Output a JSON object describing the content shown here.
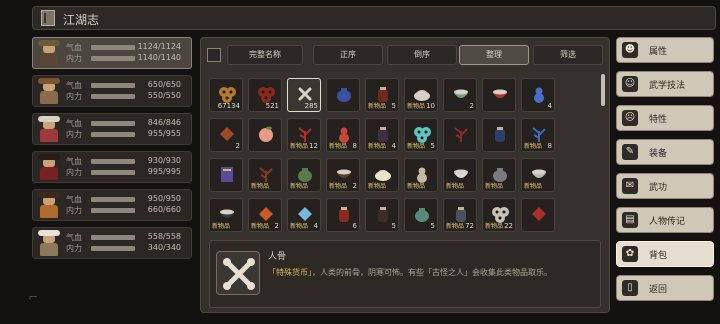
{
  "header": {
    "title": "江湖志"
  },
  "characters": [
    {
      "qi_label": "气血",
      "neili_label": "内力",
      "qi": "1124/1124",
      "neili": "1140/1140",
      "active": true,
      "hat": "#6b5a3e",
      "body": "#5a4632"
    },
    {
      "qi_label": "气血",
      "neili_label": "内力",
      "qi": "650/650",
      "neili": "550/550",
      "active": false,
      "hat": "#7a5530",
      "body": "#8a6a4a"
    },
    {
      "qi_label": "气血",
      "neili_label": "内力",
      "qi": "846/846",
      "neili": "955/955",
      "active": false,
      "hat": "#d8d0c0",
      "body": "#9a3a3a"
    },
    {
      "qi_label": "气血",
      "neili_label": "内力",
      "qi": "930/930",
      "neili": "995/995",
      "active": false,
      "hat": "#2a1c16",
      "body": "#7a2020"
    },
    {
      "qi_label": "气血",
      "neili_label": "内力",
      "qi": "950/950",
      "neili": "660/660",
      "active": false,
      "hat": "#3a2a1e",
      "body": "#b06a2a"
    },
    {
      "qi_label": "气血",
      "neili_label": "内力",
      "qi": "558/558",
      "neili": "340/340",
      "active": false,
      "hat": "#e8e2d6",
      "body": "#8a7a5a"
    }
  ],
  "toolbar": {
    "tabs": [
      {
        "label": "完整名称",
        "selected": false
      },
      {
        "label": "正序",
        "selected": false
      },
      {
        "label": "倒序",
        "selected": false
      },
      {
        "label": "整理",
        "selected": true
      },
      {
        "label": "筛选",
        "selected": false
      }
    ]
  },
  "items": [
    {
      "qty": "67134",
      "new": false,
      "color": "#b5782f",
      "shape": "coins",
      "selected": false
    },
    {
      "qty": "521",
      "new": false,
      "color": "#8b2a1c",
      "shape": "coins",
      "selected": false
    },
    {
      "qty": "285",
      "new": false,
      "color": "#d9d2c4",
      "shape": "bone",
      "selected": true
    },
    {
      "qty": "",
      "new": false,
      "color": "#3b4fa0",
      "shape": "pot",
      "selected": false
    },
    {
      "qty": "5",
      "new": true,
      "color": "#6e2a1e",
      "shape": "jar",
      "selected": false
    },
    {
      "qty": "10",
      "new": true,
      "color": "#d6cfc2",
      "shape": "bun",
      "selected": false
    },
    {
      "qty": "2",
      "new": false,
      "color": "#6ea07a",
      "shape": "bowl",
      "selected": false
    },
    {
      "qty": "",
      "new": false,
      "color": "#b0332a",
      "shape": "bowl",
      "selected": false
    },
    {
      "qty": "4",
      "new": false,
      "color": "#4a6fc8",
      "shape": "gourd",
      "selected": false
    },
    {
      "qty": "2",
      "new": false,
      "color": "#a04a2a",
      "shape": "gem",
      "selected": false
    },
    {
      "qty": "",
      "new": false,
      "color": "#e89a86",
      "shape": "peach",
      "selected": false
    },
    {
      "qty": "12",
      "new": true,
      "color": "#a8322a",
      "shape": "herb",
      "selected": false
    },
    {
      "qty": "8",
      "new": true,
      "color": "#c8453a",
      "shape": "gourd",
      "selected": false
    },
    {
      "qty": "4",
      "new": true,
      "color": "#3e3044",
      "shape": "jar",
      "selected": false
    },
    {
      "qty": "5",
      "new": true,
      "color": "#5ac8c0",
      "shape": "coins",
      "selected": false
    },
    {
      "qty": "",
      "new": false,
      "color": "#8a2a2a",
      "shape": "herb",
      "selected": false
    },
    {
      "qty": "",
      "new": false,
      "color": "#2c3e6a",
      "shape": "jar",
      "selected": false
    },
    {
      "qty": "8",
      "new": true,
      "color": "#3a6ab8",
      "shape": "herb",
      "selected": false
    },
    {
      "qty": "",
      "new": false,
      "color": "#5a4a9a",
      "shape": "book",
      "selected": false
    },
    {
      "qty": "",
      "new": true,
      "color": "#8a3a22",
      "shape": "herb",
      "selected": false
    },
    {
      "qty": "",
      "new": true,
      "color": "#5a7a4a",
      "shape": "pot",
      "selected": false
    },
    {
      "qty": "2",
      "new": true,
      "color": "#6a3a2a",
      "shape": "bowl",
      "selected": false
    },
    {
      "qty": "",
      "new": true,
      "color": "#e8e2c8",
      "shape": "bun",
      "selected": false
    },
    {
      "qty": "",
      "new": true,
      "color": "#c8b8a0",
      "shape": "gourd",
      "selected": false
    },
    {
      "qty": "",
      "new": true,
      "color": "#d8d8d8",
      "shape": "bowl",
      "selected": false
    },
    {
      "qty": "",
      "new": true,
      "color": "#7a7a80",
      "shape": "pot",
      "selected": false
    },
    {
      "qty": "",
      "new": true,
      "color": "#b8b8b0",
      "shape": "bowl",
      "selected": false
    },
    {
      "qty": "",
      "new": true,
      "color": "#3a3a3a",
      "shape": "bowl",
      "selected": false
    },
    {
      "qty": "2",
      "new": true,
      "color": "#c85a2a",
      "shape": "gem",
      "selected": false
    },
    {
      "qty": "4",
      "new": true,
      "color": "#7ab8d8",
      "shape": "gem",
      "selected": false
    },
    {
      "qty": "6",
      "new": false,
      "color": "#8a2a1e",
      "shape": "jar",
      "selected": false
    },
    {
      "qty": "5",
      "new": false,
      "color": "#3a2e26",
      "shape": "jar",
      "selected": false
    },
    {
      "qty": "5",
      "new": false,
      "color": "#5a8a7a",
      "shape": "pot",
      "selected": false
    },
    {
      "qty": "72",
      "new": true,
      "color": "#4a5060",
      "shape": "jar",
      "selected": false
    },
    {
      "qty": "22",
      "new": true,
      "color": "#c8c2b4",
      "shape": "coins",
      "selected": false
    },
    {
      "qty": "",
      "new": false,
      "color": "#a8302a",
      "shape": "gem",
      "selected": false
    }
  ],
  "detail": {
    "name": "人骨",
    "tag": "「特殊货币」",
    "desc": "，人类的前骨，阴寒可怖。有些「古怪之人」会收集此类物品取乐。",
    "icon": "bone-icon"
  },
  "sidemenu": [
    {
      "label": "属性",
      "icon": "☻",
      "icon_name": "attributes-icon",
      "active": false
    },
    {
      "label": "武学技法",
      "icon": "☺",
      "icon_name": "martial-skill-icon",
      "active": false
    },
    {
      "label": "特性",
      "icon": "☹",
      "icon_name": "trait-icon",
      "active": false
    },
    {
      "label": "装备",
      "icon": "✎",
      "icon_name": "sword-icon",
      "active": false
    },
    {
      "label": "武功",
      "icon": "✉",
      "icon_name": "scroll-icon",
      "active": false
    },
    {
      "label": "人物传记",
      "icon": "▤",
      "icon_name": "book-icon",
      "active": false
    },
    {
      "label": "背包",
      "icon": "✿",
      "icon_name": "bag-icon",
      "active": true
    },
    {
      "label": "返回",
      "icon": "▯",
      "icon_name": "door-icon",
      "active": false
    }
  ]
}
